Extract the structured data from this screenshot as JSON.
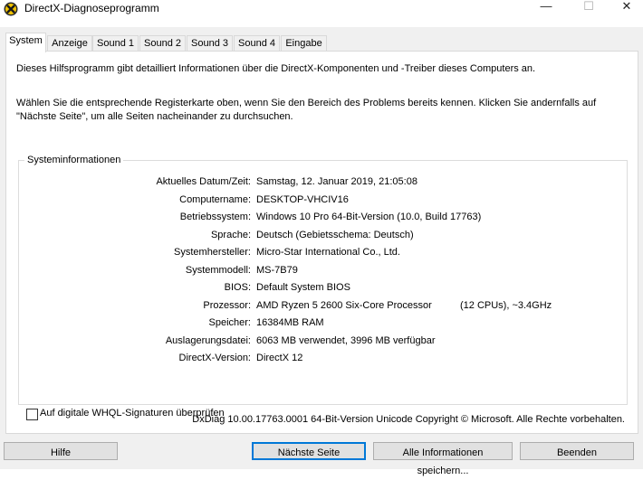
{
  "window": {
    "title": "DirectX-Diagnoseprogramm",
    "minimize_glyph": "—",
    "maximize_glyph": "☐",
    "close_glyph": "✕",
    "app_icon": "directx-x-icon"
  },
  "tabs": [
    {
      "label": "System"
    },
    {
      "label": "Anzeige"
    },
    {
      "label": "Sound 1"
    },
    {
      "label": "Sound 2"
    },
    {
      "label": "Sound 3"
    },
    {
      "label": "Sound 4"
    },
    {
      "label": "Eingabe"
    }
  ],
  "intro": {
    "line1": "Dieses Hilfsprogramm gibt detailliert Informationen über die DirectX-Komponenten und -Treiber dieses Computers an.",
    "line2": "Wählen Sie die entsprechende Registerkarte oben, wenn Sie den Bereich des Problems bereits kennen. Klicken Sie andernfalls auf \"Nächste Seite\", um alle Seiten nacheinander zu durchsuchen."
  },
  "sysinfo": {
    "title": "Systeminformationen",
    "rows": [
      {
        "label": "Aktuelles Datum/Zeit:",
        "value": "Samstag, 12. Januar 2019, 21:05:08"
      },
      {
        "label": "Computername:",
        "value": "DESKTOP-VHCIV16"
      },
      {
        "label": "Betriebssystem:",
        "value": "Windows 10 Pro 64-Bit-Version (10.0, Build 17763)"
      },
      {
        "label": "Sprache:",
        "value": "Deutsch (Gebietsschema: Deutsch)"
      },
      {
        "label": "Systemhersteller:",
        "value": "Micro-Star International Co., Ltd."
      },
      {
        "label": "Systemmodell:",
        "value": "MS-7B79"
      },
      {
        "label": "BIOS:",
        "value": "Default System BIOS"
      },
      {
        "label": "Prozessor:",
        "value": "AMD Ryzen 5 2600 Six-Core Processor",
        "value2": "(12 CPUs), ~3.4GHz"
      },
      {
        "label": "Speicher:",
        "value": "16384MB RAM"
      },
      {
        "label": "Auslagerungsdatei:",
        "value": "6063 MB verwendet, 3996 MB verfügbar"
      },
      {
        "label": "DirectX-Version:",
        "value": "DirectX 12"
      }
    ]
  },
  "whql_checkbox": {
    "label": "Auf digitale WHQL-Signaturen überprüfen",
    "checked": false
  },
  "footer": "DxDiag 10.00.17763.0001 64-Bit-Version Unicode Copyright © Microsoft. Alle Rechte vorbehalten.",
  "buttons": {
    "help": "Hilfe",
    "next_page": "Nächste Seite",
    "save_all": "Alle Informationen speichern...",
    "exit": "Beenden"
  }
}
